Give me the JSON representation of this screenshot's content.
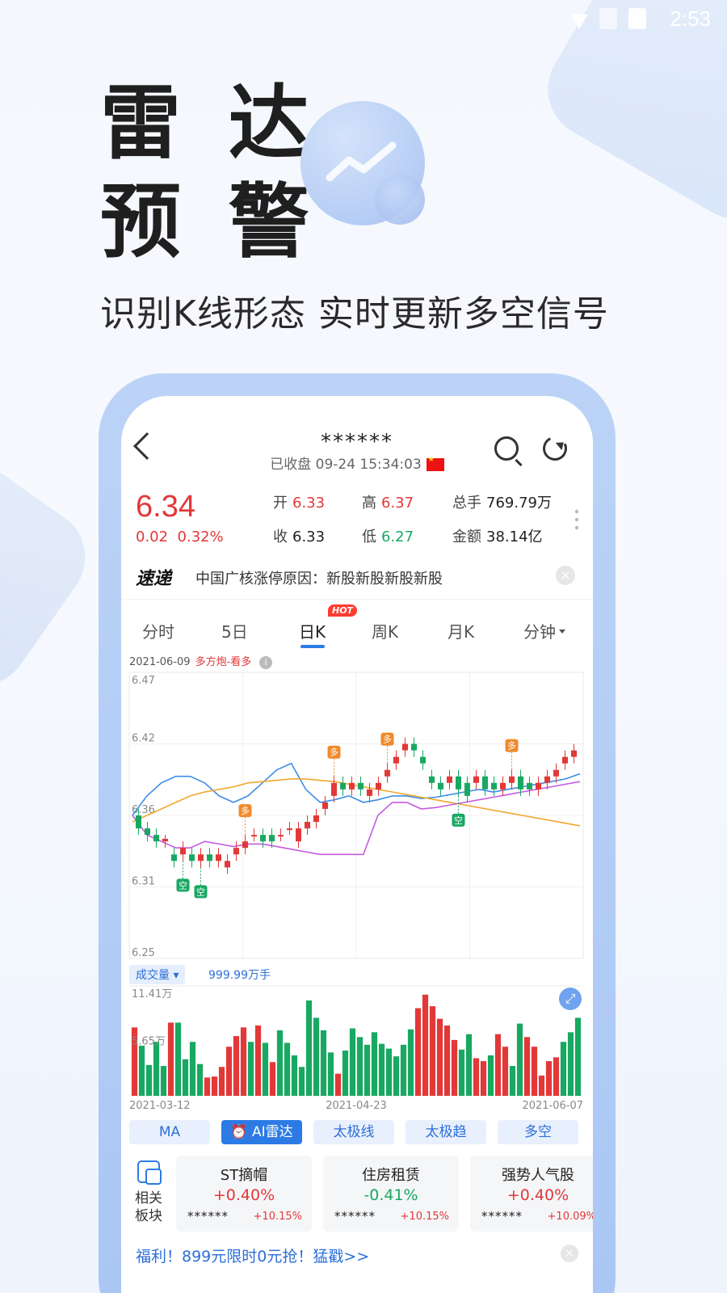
{
  "status_bar": {
    "time": "2:53"
  },
  "hero": {
    "line1": "雷 达",
    "line2": "预 警",
    "subtitle": "识别K线形态 实时更新多空信号"
  },
  "header": {
    "stock_name": "******",
    "market_status": "已收盘 09-24 15:34:03"
  },
  "quote": {
    "price": "6.34",
    "change": "0.02",
    "change_pct": "0.32%",
    "open_label": "开",
    "open": "6.33",
    "high_label": "高",
    "high": "6.37",
    "volume_label": "总手",
    "volume": "769.79万",
    "close_label": "收",
    "close": "6.33",
    "low_label": "低",
    "low": "6.27",
    "amount_label": "金额",
    "amount": "38.14亿"
  },
  "news": {
    "logo": "速递",
    "text": "中国广核涨停原因：新股新股新股新股"
  },
  "tabs": [
    {
      "label": "分时"
    },
    {
      "label": "5日"
    },
    {
      "label": "日K"
    },
    {
      "label": "周K"
    },
    {
      "label": "月K"
    },
    {
      "label": "分钟"
    }
  ],
  "hot_badge": "HOT",
  "signal": {
    "date": "2021-06-09",
    "text": "多方炮-看多"
  },
  "volume_panel": {
    "selector": "成交量",
    "value": "999.99万手"
  },
  "indicators": [
    {
      "label": "MA"
    },
    {
      "label": "AI雷达"
    },
    {
      "label": "太极线"
    },
    {
      "label": "太极趋"
    },
    {
      "label": "多空"
    }
  ],
  "sector_label": "相关板块",
  "sectors": [
    {
      "name": "ST摘帽",
      "pct": "+0.40%",
      "stock": "******",
      "stock_pct": "+10.15%"
    },
    {
      "name": "住房租赁",
      "pct": "-0.41%",
      "stock": "******",
      "stock_pct": "+10.15%"
    },
    {
      "name": "强势人气股",
      "pct": "+0.40%",
      "stock": "******",
      "stock_pct": "+10.09%"
    }
  ],
  "promo": "福利！899元限时0元抢！猛戳>>",
  "chart_data": [
    {
      "type": "candlestick",
      "y_ticks": [
        "6.47",
        "6.42",
        "6.36",
        "6.31",
        "6.25"
      ],
      "ylim": [
        6.25,
        6.47
      ],
      "grid": true,
      "candles": [
        [
          6.36,
          6.35,
          6.365,
          6.345
        ],
        [
          6.35,
          6.345,
          6.355,
          6.34
        ],
        [
          6.345,
          6.34,
          6.35,
          6.335
        ],
        [
          6.34,
          6.342,
          6.345,
          6.335
        ],
        [
          6.33,
          6.325,
          6.335,
          6.32
        ],
        [
          6.33,
          6.335,
          6.34,
          6.325
        ],
        [
          6.33,
          6.325,
          6.335,
          6.32
        ],
        [
          6.325,
          6.33,
          6.335,
          6.32
        ],
        [
          6.33,
          6.325,
          6.335,
          6.32
        ],
        [
          6.325,
          6.33,
          6.335,
          6.32
        ],
        [
          6.32,
          6.325,
          6.33,
          6.315
        ],
        [
          6.33,
          6.335,
          6.34,
          6.325
        ],
        [
          6.335,
          6.34,
          6.345,
          6.33
        ],
        [
          6.345,
          6.345,
          6.35,
          6.34
        ],
        [
          6.345,
          6.34,
          6.35,
          6.335
        ],
        [
          6.345,
          6.34,
          6.35,
          6.335
        ],
        [
          6.345,
          6.345,
          6.35,
          6.34
        ],
        [
          6.35,
          6.35,
          6.355,
          6.345
        ],
        [
          6.34,
          6.35,
          6.355,
          6.335
        ],
        [
          6.35,
          6.355,
          6.36,
          6.345
        ],
        [
          6.355,
          6.36,
          6.365,
          6.35
        ],
        [
          6.365,
          6.37,
          6.375,
          6.36
        ],
        [
          6.375,
          6.385,
          6.39,
          6.37
        ],
        [
          6.385,
          6.38,
          6.39,
          6.375
        ],
        [
          6.38,
          6.385,
          6.39,
          6.375
        ],
        [
          6.385,
          6.38,
          6.39,
          6.375
        ],
        [
          6.375,
          6.38,
          6.385,
          6.37
        ],
        [
          6.38,
          6.385,
          6.39,
          6.375
        ],
        [
          6.39,
          6.395,
          6.4,
          6.385
        ],
        [
          6.4,
          6.405,
          6.41,
          6.395
        ],
        [
          6.41,
          6.415,
          6.42,
          6.405
        ],
        [
          6.415,
          6.41,
          6.42,
          6.405
        ],
        [
          6.405,
          6.4,
          6.41,
          6.395
        ],
        [
          6.39,
          6.385,
          6.395,
          6.38
        ],
        [
          6.385,
          6.38,
          6.39,
          6.375
        ],
        [
          6.385,
          6.39,
          6.395,
          6.38
        ],
        [
          6.39,
          6.38,
          6.395,
          6.375
        ],
        [
          6.385,
          6.375,
          6.39,
          6.37
        ],
        [
          6.385,
          6.39,
          6.395,
          6.38
        ],
        [
          6.39,
          6.38,
          6.395,
          6.375
        ],
        [
          6.385,
          6.38,
          6.39,
          6.375
        ],
        [
          6.38,
          6.385,
          6.39,
          6.375
        ],
        [
          6.385,
          6.39,
          6.395,
          6.38
        ],
        [
          6.39,
          6.38,
          6.395,
          6.375
        ],
        [
          6.385,
          6.38,
          6.39,
          6.375
        ],
        [
          6.38,
          6.385,
          6.39,
          6.375
        ],
        [
          6.385,
          6.39,
          6.395,
          6.38
        ],
        [
          6.39,
          6.395,
          6.4,
          6.385
        ],
        [
          6.4,
          6.405,
          6.41,
          6.395
        ],
        [
          6.405,
          6.41,
          6.415,
          6.4
        ]
      ],
      "signals": [
        {
          "index": 5,
          "type": "空"
        },
        {
          "index": 7,
          "type": "空"
        },
        {
          "index": 12,
          "type": "多"
        },
        {
          "index": 22,
          "type": "多"
        },
        {
          "index": 28,
          "type": "多"
        },
        {
          "index": 36,
          "type": "空"
        },
        {
          "index": 42,
          "type": "多"
        },
        {
          "index": 53,
          "type": "空"
        },
        {
          "index": 61,
          "type": "多"
        }
      ],
      "series": [
        {
          "values": [
            6.36,
            6.375,
            6.385,
            6.39,
            6.39,
            6.385,
            6.375,
            6.37,
            6.375,
            6.385,
            6.395,
            6.4,
            6.38,
            6.37,
            6.372,
            6.375,
            6.37,
            6.372,
            6.375,
            6.375,
            6.373,
            6.374,
            6.376,
            6.378,
            6.38,
            6.378,
            6.38,
            6.382,
            6.384,
            6.386,
            6.388,
            6.392
          ]
        },
        {
          "values": [
            6.355,
            6.36,
            6.365,
            6.37,
            6.375,
            6.378,
            6.38,
            6.382,
            6.385,
            6.386,
            6.387,
            6.388,
            6.388,
            6.387,
            6.386,
            6.384,
            6.382,
            6.38,
            6.378,
            6.376,
            6.374,
            6.372,
            6.37,
            6.368,
            6.366,
            6.364,
            6.362,
            6.36,
            6.358,
            6.356,
            6.354,
            6.352
          ]
        },
        {
          "values": [
            6.36,
            6.345,
            6.34,
            6.335,
            6.335,
            6.34,
            6.338,
            6.336,
            6.338,
            6.338,
            6.336,
            6.334,
            6.332,
            6.33,
            6.33,
            6.33,
            6.33,
            6.36,
            6.37,
            6.37,
            6.365,
            6.366,
            6.368,
            6.37,
            6.372,
            6.374,
            6.376,
            6.378,
            6.38,
            6.382,
            6.384,
            6.386
          ]
        }
      ]
    },
    {
      "type": "bar",
      "title": "成交量",
      "y_ticks": [
        "11.41万",
        "5.65万"
      ],
      "x_ticks": [
        "2021-03-12",
        "2021-04-23",
        "2021-06-07"
      ],
      "values": [
        7.1,
        5.2,
        3.2,
        5.6,
        3.1,
        7.6,
        7.6,
        3.8,
        5.6,
        3.3,
        1.9,
        2.0,
        3.0,
        5.1,
        6.2,
        7.1,
        5.6,
        7.3,
        5.5,
        3.5,
        6.8,
        5.5,
        4.2,
        3.0,
        9.9,
        8.1,
        6.8,
        4.5,
        2.3,
        4.7,
        7.0,
        6.1,
        5.3,
        6.6,
        5.4,
        4.9,
        4.1,
        5.3,
        6.9,
        9.1,
        10.5,
        9.3,
        8.0,
        7.3,
        5.8,
        4.8,
        6.4,
        3.9,
        3.6,
        4.2,
        6.4,
        5.1,
        3.1,
        7.5,
        6.1,
        5.1,
        2.1,
        3.6,
        4.0,
        5.6,
        6.6,
        8.1
      ],
      "up": [
        1,
        0,
        0,
        0,
        0,
        1,
        0,
        0,
        0,
        0,
        1,
        1,
        1,
        1,
        1,
        1,
        0,
        1,
        0,
        1,
        0,
        0,
        0,
        0,
        0,
        0,
        0,
        0,
        1,
        0,
        0,
        0,
        0,
        0,
        0,
        0,
        0,
        0,
        0,
        1,
        1,
        1,
        1,
        1,
        1,
        0,
        0,
        1,
        1,
        0,
        1,
        1,
        0,
        0,
        1,
        1,
        1,
        1,
        1,
        0,
        0,
        0
      ]
    }
  ],
  "colors": {
    "accent": "#2c7be5",
    "up": "#e23838",
    "down": "#18a862",
    "ma5": "#3d8de6",
    "ma10": "#f0a830",
    "ma20": "#c45be0"
  }
}
